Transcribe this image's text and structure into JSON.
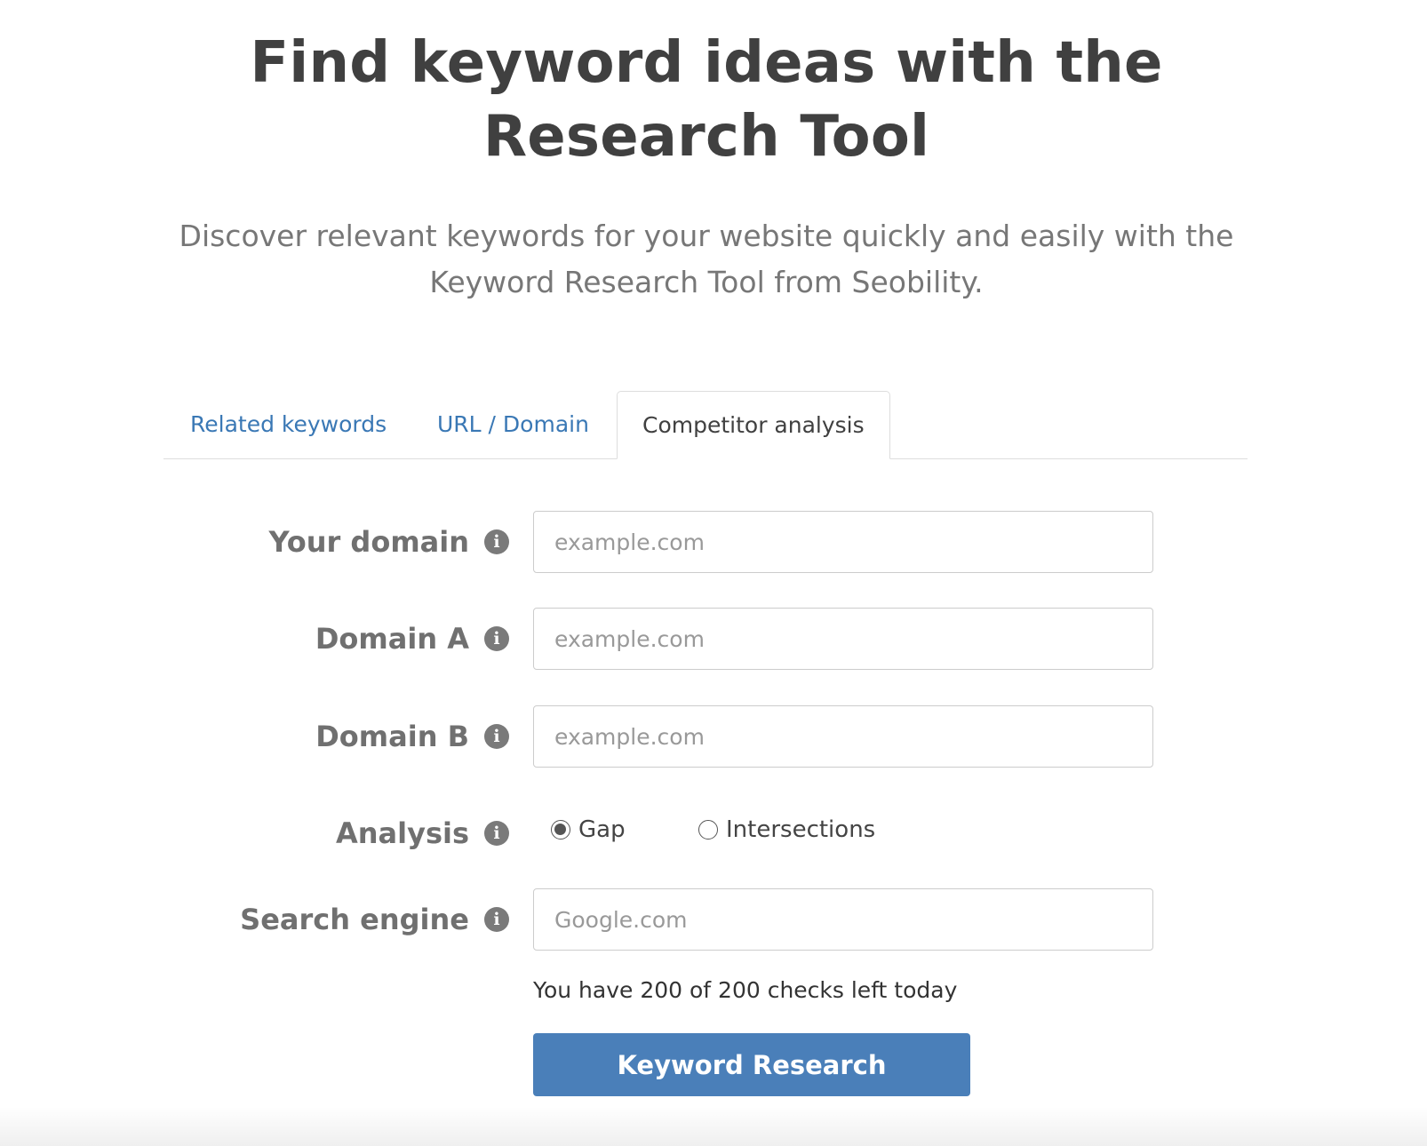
{
  "hero": {
    "title_line1": "Find keyword ideas with the",
    "title_line2": "Research Tool",
    "subtitle_line1": "Discover relevant keywords for your website quickly and easily with the",
    "subtitle_line2": "Keyword Research Tool from Seobility."
  },
  "tabs": [
    {
      "label": "Related keywords",
      "active": false
    },
    {
      "label": "URL / Domain",
      "active": false
    },
    {
      "label": "Competitor analysis",
      "active": true
    }
  ],
  "form": {
    "your_domain": {
      "label": "Your domain",
      "placeholder": "example.com",
      "value": ""
    },
    "domain_a": {
      "label": "Domain A",
      "placeholder": "example.com",
      "value": ""
    },
    "domain_b": {
      "label": "Domain B",
      "placeholder": "example.com",
      "value": ""
    },
    "analysis": {
      "label": "Analysis",
      "options": [
        {
          "label": "Gap",
          "checked": true
        },
        {
          "label": "Intersections",
          "checked": false
        }
      ]
    },
    "search_engine": {
      "label": "Search engine",
      "placeholder": "Google.com",
      "value": ""
    },
    "info_icon_glyph": "i",
    "checks_left": "You have 200 of 200 checks left today",
    "submit_label": "Keyword Research"
  },
  "colors": {
    "link": "#3a78b5",
    "button": "#4a7fb9",
    "heading": "#404040",
    "label": "#707070"
  }
}
